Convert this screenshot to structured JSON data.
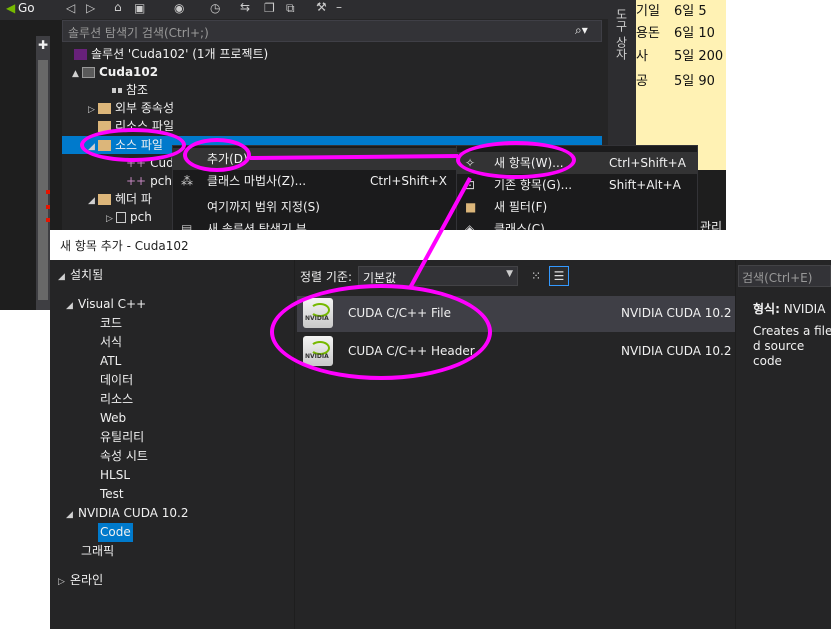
{
  "ide": {
    "toolbar_go": "Go"
  },
  "solution_explorer": {
    "search_placeholder": "솔루션 탐색기 검색(Ctrl+;)",
    "side_tab": "도구 상자",
    "tree": [
      {
        "label": "솔루션 'Cuda102' (1개 프로젝트)",
        "level": 0,
        "arrow": ""
      },
      {
        "label": "Cuda102",
        "level": 0,
        "arrow": "▲"
      },
      {
        "label": "참조",
        "level": 1,
        "arrow": ""
      },
      {
        "label": "외부 종속성",
        "level": 1,
        "arrow": "▷"
      },
      {
        "label": "리소스 파일",
        "level": 1,
        "arrow": ""
      },
      {
        "label": "소스 파일",
        "level": 1,
        "arrow": "◢"
      },
      {
        "label": "Cud",
        "level": 2,
        "arrow": ""
      },
      {
        "label": "pch",
        "level": 2,
        "arrow": ""
      },
      {
        "label": "헤더 파",
        "level": 1,
        "arrow": "◢"
      },
      {
        "label": "pch",
        "level": 2,
        "arrow": "▷"
      }
    ]
  },
  "side_notes": [
    {
      "label": "기일",
      "value": "6일 5"
    },
    {
      "label": "용돈",
      "value": "6일 10"
    },
    {
      "label": "사",
      "value": "5일 200"
    },
    {
      "label": "공",
      "value": "5일 90"
    }
  ],
  "side_fragment": "관리",
  "context_menu": [
    {
      "label": "추가(D)",
      "shortcut": ""
    },
    {
      "label": "클래스 마법사(Z)...",
      "shortcut": "Ctrl+Shift+X"
    },
    {
      "label": "여기까지 범위 지정(S)",
      "shortcut": ""
    },
    {
      "label": "새 솔루션 탐색기 뷰",
      "shortcut": ""
    }
  ],
  "submenu": [
    {
      "label": "새 항목(W)...",
      "shortcut": "Ctrl+Shift+A"
    },
    {
      "label": "기존 항목(G)...",
      "shortcut": "Shift+Alt+A"
    },
    {
      "label": "새 필터(F)",
      "shortcut": ""
    },
    {
      "label": "클래스(C)",
      "shortcut": ""
    }
  ],
  "dialog": {
    "title": "새 항목 추가 - Cuda102",
    "sort_label": "정렬 기준:",
    "sort_value": "기본값",
    "search_placeholder": "검색(Ctrl+E)",
    "categories": [
      {
        "label": "설치됨",
        "arrow": "◢",
        "level": 0
      },
      {
        "label": "Visual C++",
        "arrow": "◢",
        "level": 1
      },
      {
        "label": "코드",
        "arrow": "",
        "level": 2
      },
      {
        "label": "서식",
        "arrow": "",
        "level": 2
      },
      {
        "label": "ATL",
        "arrow": "",
        "level": 2
      },
      {
        "label": "데이터",
        "arrow": "",
        "level": 2
      },
      {
        "label": "리소스",
        "arrow": "",
        "level": 2
      },
      {
        "label": "Web",
        "arrow": "",
        "level": 2
      },
      {
        "label": "유틸리티",
        "arrow": "",
        "level": 2
      },
      {
        "label": "속성 시트",
        "arrow": "",
        "level": 2
      },
      {
        "label": "HLSL",
        "arrow": "",
        "level": 2
      },
      {
        "label": "Test",
        "arrow": "",
        "level": 2
      },
      {
        "label": "NVIDIA CUDA 10.2",
        "arrow": "◢",
        "level": 1
      },
      {
        "label": "Code",
        "arrow": "",
        "level": 2
      },
      {
        "label": "그래픽",
        "arrow": "",
        "level": 1
      },
      {
        "label": "온라인",
        "arrow": "▷",
        "level": 0
      }
    ],
    "templates": [
      {
        "name": "CUDA C/C++ File",
        "type": "NVIDIA CUDA 10.2",
        "logo": "NVIDIA"
      },
      {
        "name": "CUDA C/C++ Header",
        "type": "NVIDIA CUDA 10.2",
        "logo": "NVIDIA"
      }
    ],
    "info": {
      "type_label": "형식:",
      "type_value": "NVIDIA",
      "description": "Creates a file d source code"
    }
  },
  "colors": {
    "annotation": "#ff00ff",
    "selection": "#007acc"
  }
}
